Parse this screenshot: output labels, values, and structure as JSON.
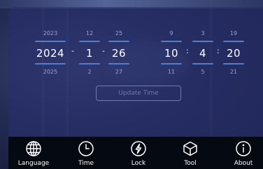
{
  "date": {
    "year": {
      "prev": "2023",
      "current": "2024",
      "next": "2025"
    },
    "month": {
      "prev": "12",
      "current": "1",
      "next": "2"
    },
    "day": {
      "prev": "25",
      "current": "26",
      "next": "27"
    },
    "separator": "-"
  },
  "time": {
    "hour": {
      "prev": "9",
      "current": "10",
      "next": "11"
    },
    "minute": {
      "prev": "3",
      "current": "4",
      "next": "5"
    },
    "second": {
      "prev": "19",
      "current": "20",
      "next": "21"
    },
    "separator": ":"
  },
  "update_button": {
    "label": "Update Time"
  },
  "nav": {
    "items": [
      {
        "label": "Language",
        "icon": "globe-icon"
      },
      {
        "label": "Time",
        "icon": "clock-icon"
      },
      {
        "label": "Lock",
        "icon": "lock-bolt-icon"
      },
      {
        "label": "Tool",
        "icon": "cube-icon"
      },
      {
        "label": "About",
        "icon": "info-icon"
      }
    ]
  },
  "colors": {
    "accent": "#4a7fd8",
    "panel": "#282e6e",
    "navbar": "#050912"
  }
}
